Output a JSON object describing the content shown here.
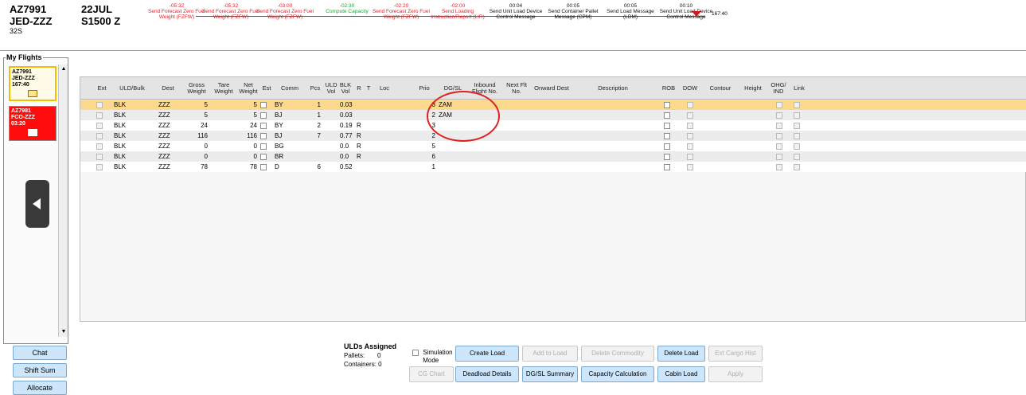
{
  "flight": {
    "number": "AZ7991",
    "route": "JED-ZZZ",
    "aircraft": "32S",
    "date": "22JUL",
    "std": "S1500 Z"
  },
  "timeline": [
    {
      "time": "-05:32",
      "label": "Send Forecast Zero Fuel Weight (FZFW)",
      "color": "red"
    },
    {
      "time": "-05:32",
      "label": "Send Forecast Zero Fuel Weight (FZFW)",
      "color": "red"
    },
    {
      "time": "-03:00",
      "label": "Send Forecast Zero Fuel Weight (FZFW)",
      "color": "red"
    },
    {
      "time": "-02:30",
      "label": "Compute Capacity",
      "color": "green"
    },
    {
      "time": "-02:20",
      "label": "Send Forecast Zero Fuel Weight (FZFW)",
      "color": "red"
    },
    {
      "time": "-02:00",
      "label": "Send Loading Instruction/Report (LIR)",
      "color": "red"
    },
    {
      "time": "00:04",
      "label": "Send Unit Load Device Control Message",
      "color": "black"
    },
    {
      "time": "00:05",
      "label": "Send Container Pallet Message (CPM)",
      "color": "black"
    },
    {
      "time": "00:05",
      "label": "Send Load Message (LDM)",
      "color": "black"
    },
    {
      "time": "00:10",
      "label": "Send Unit Load Device Control Message",
      "color": "black"
    }
  ],
  "now_time": "167:40",
  "my_flights": {
    "title": "My Flights",
    "cards": [
      {
        "line1": "AZ7991",
        "line2": "JED-ZZZ",
        "line3": "167:40"
      },
      {
        "line1": "AZ7981",
        "line2": "FCO-ZZZ",
        "line3": "03:20"
      }
    ]
  },
  "side_buttons": {
    "chat": "Chat",
    "shift_sum": "Shift Sum",
    "allocate": "Allocate"
  },
  "columns": [
    "Ext",
    "ULD/Bulk",
    "Dest",
    "Gross Weight",
    "Tare Weight",
    "Net Weight",
    "Est",
    "Comm",
    "Pcs",
    "ULD Vol",
    "BLK Vol",
    "R",
    "T",
    "Loc",
    "Prio",
    "DG/SL",
    "Inbound Flight No.",
    "Next Flt No.",
    "Onward Dest",
    "Description",
    "ROB",
    "DOW",
    "Contour",
    "Height",
    "OHG/ IND",
    "Link"
  ],
  "rows": [
    {
      "uld": "BLK",
      "dest": "ZZZ",
      "gross": "5",
      "net": "5",
      "comm": "BY",
      "pcs": "1",
      "blk": "0.03",
      "r": "",
      "prio": "3",
      "dgsl": "ZAM"
    },
    {
      "uld": "BLK",
      "dest": "ZZZ",
      "gross": "5",
      "net": "5",
      "comm": "BJ",
      "pcs": "1",
      "blk": "0.03",
      "r": "",
      "prio": "2",
      "dgsl": "ZAM"
    },
    {
      "uld": "BLK",
      "dest": "ZZZ",
      "gross": "24",
      "net": "24",
      "comm": "BY",
      "pcs": "2",
      "blk": "0.19",
      "r": "R",
      "prio": "3",
      "dgsl": ""
    },
    {
      "uld": "BLK",
      "dest": "ZZZ",
      "gross": "116",
      "net": "116",
      "comm": "BJ",
      "pcs": "7",
      "blk": "0.77",
      "r": "R",
      "prio": "2",
      "dgsl": ""
    },
    {
      "uld": "BLK",
      "dest": "ZZZ",
      "gross": "0",
      "net": "0",
      "comm": "BG",
      "pcs": "",
      "blk": "0.0",
      "r": "R",
      "prio": "5",
      "dgsl": ""
    },
    {
      "uld": "BLK",
      "dest": "ZZZ",
      "gross": "0",
      "net": "0",
      "comm": "BR",
      "pcs": "",
      "blk": "0.0",
      "r": "R",
      "prio": "6",
      "dgsl": ""
    },
    {
      "uld": "BLK",
      "dest": "ZZZ",
      "gross": "78",
      "net": "78",
      "comm": "D",
      "pcs": "6",
      "blk": "0.52",
      "r": "",
      "prio": "1",
      "dgsl": ""
    }
  ],
  "uld_assigned": {
    "title": "ULDs Assigned",
    "pallets_label": "Pallets:",
    "pallets": "0",
    "containers_label": "Containers:",
    "containers": "0"
  },
  "simulation_mode": "Simulation Mode",
  "buttons": {
    "create_load": "Create Load",
    "add_to_load": "Add to Load",
    "delete_commodity": "Delete Commodity",
    "delete_load": "Delete Load",
    "ext_cargo_hist": "Ext Cargo Hist",
    "cg_chart": "CG Chart",
    "deadload_details": "Deadload Details",
    "dgsl_summary": "DG/SL Summary",
    "capacity_calculation": "Capacity Calculation",
    "cabin_load": "Cabin Load",
    "apply": "Apply"
  }
}
